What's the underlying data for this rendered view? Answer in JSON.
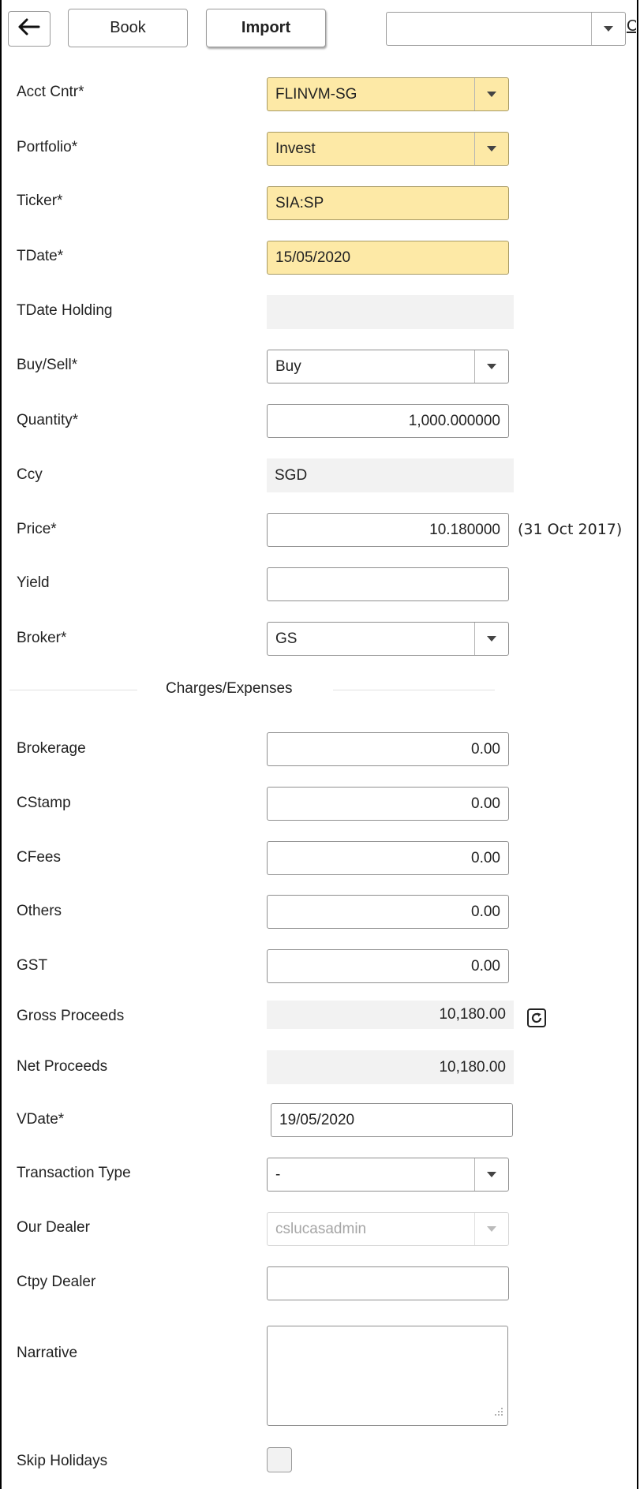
{
  "toolbar": {
    "back_icon": "arrow-left-icon",
    "book_label": "Book",
    "import_label": "Import",
    "top_select_value": "",
    "cut_link_text": "C"
  },
  "form": {
    "acct_cntr": {
      "label": "Acct Cntr*",
      "value": "FLINVM-SG"
    },
    "portfolio": {
      "label": "Portfolio*",
      "value": "Invest"
    },
    "ticker": {
      "label": "Ticker*",
      "value": "SIA:SP"
    },
    "tdate": {
      "label": "TDate*",
      "value": "15/05/2020"
    },
    "tdate_holding": {
      "label": "TDate Holding",
      "value": ""
    },
    "buy_sell": {
      "label": "Buy/Sell*",
      "value": "Buy"
    },
    "quantity": {
      "label": "Quantity*",
      "value": "1,000.000000"
    },
    "ccy": {
      "label": "Ccy",
      "value": "SGD"
    },
    "price": {
      "label": "Price*",
      "value": "10.180000",
      "note": "(31 Oct 2017)"
    },
    "yield": {
      "label": "Yield",
      "value": ""
    },
    "broker": {
      "label": "Broker*",
      "value": "GS"
    }
  },
  "charges": {
    "section_title": "Charges/Expenses",
    "brokerage": {
      "label": "Brokerage",
      "value": "0.00"
    },
    "cstamp": {
      "label": "CStamp",
      "value": "0.00"
    },
    "cfees": {
      "label": "CFees",
      "value": "0.00"
    },
    "others": {
      "label": "Others",
      "value": "0.00"
    },
    "gst": {
      "label": "GST",
      "value": "0.00"
    },
    "gross_proceeds": {
      "label": "Gross Proceeds",
      "value": "10,180.00"
    },
    "net_proceeds": {
      "label": "Net Proceeds",
      "value": "10,180.00"
    },
    "vdate": {
      "label": "VDate*",
      "value": "19/05/2020"
    },
    "transaction_type": {
      "label": "Transaction Type",
      "value": "-"
    },
    "our_dealer": {
      "label": "Our Dealer",
      "value": "cslucasadmin"
    },
    "ctpy_dealer": {
      "label": "Ctpy Dealer",
      "value": ""
    },
    "narrative": {
      "label": "Narrative",
      "value": ""
    },
    "skip_holidays": {
      "label": "Skip Holidays",
      "checked": false
    }
  },
  "colors": {
    "required_field_bg": "#fde9a6",
    "readonly_bg": "#f2f2f2"
  }
}
